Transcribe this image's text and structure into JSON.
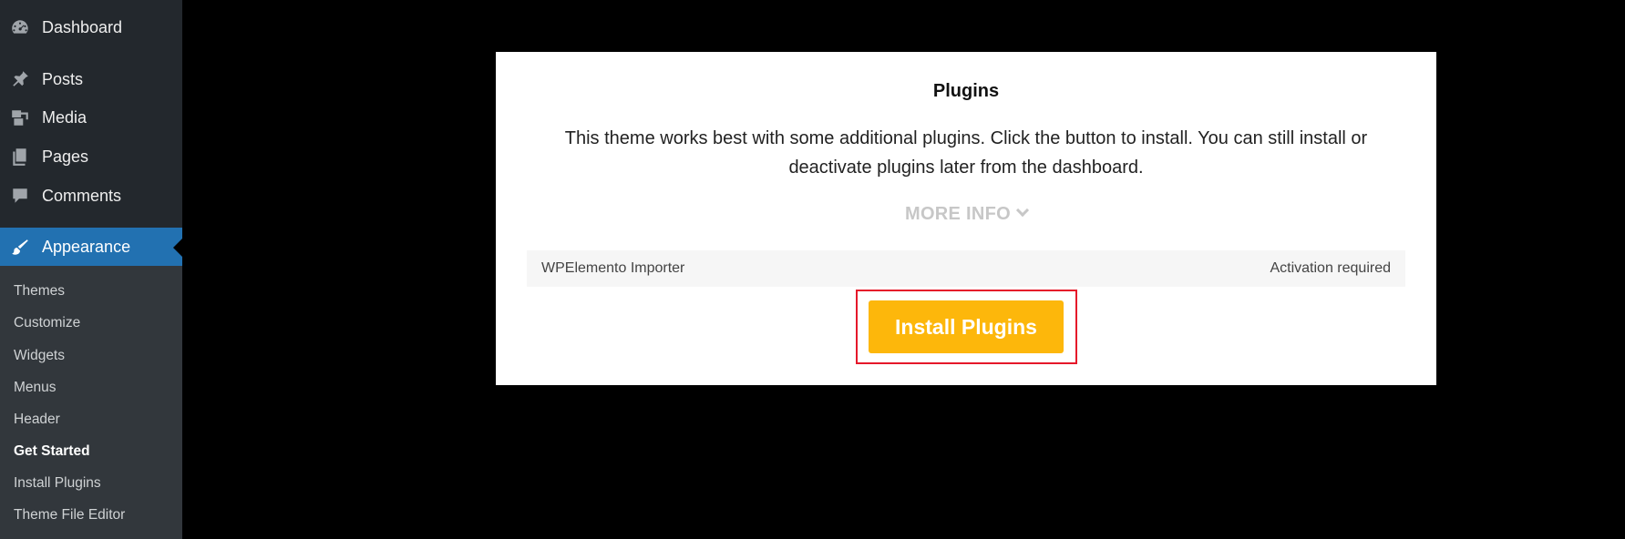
{
  "sidebar": {
    "top_item": {
      "label": "Dashboard",
      "icon": "dashboard-icon"
    },
    "items": [
      {
        "label": "Posts",
        "icon": "pin-icon"
      },
      {
        "label": "Media",
        "icon": "media-icon"
      },
      {
        "label": "Pages",
        "icon": "pages-icon"
      },
      {
        "label": "Comments",
        "icon": "comment-icon"
      }
    ],
    "active_item": {
      "label": "Appearance",
      "icon": "brush-icon"
    },
    "submenu": [
      "Themes",
      "Customize",
      "Widgets",
      "Menus",
      "Header",
      "Get Started",
      "Install Plugins",
      "Theme File Editor"
    ],
    "current_submenu": "Get Started"
  },
  "panel": {
    "title": "Plugins",
    "description": "This theme works best with some additional plugins. Click the button to install. You can still install or deactivate plugins later from the dashboard.",
    "more_info": "MORE INFO",
    "plugin": {
      "name": "WPElemento Importer",
      "status": "Activation required"
    },
    "install_button": "Install Plugins"
  },
  "colors": {
    "accent": "#2271b1",
    "button": "#fdb70b",
    "highlight": "#e5182a"
  }
}
